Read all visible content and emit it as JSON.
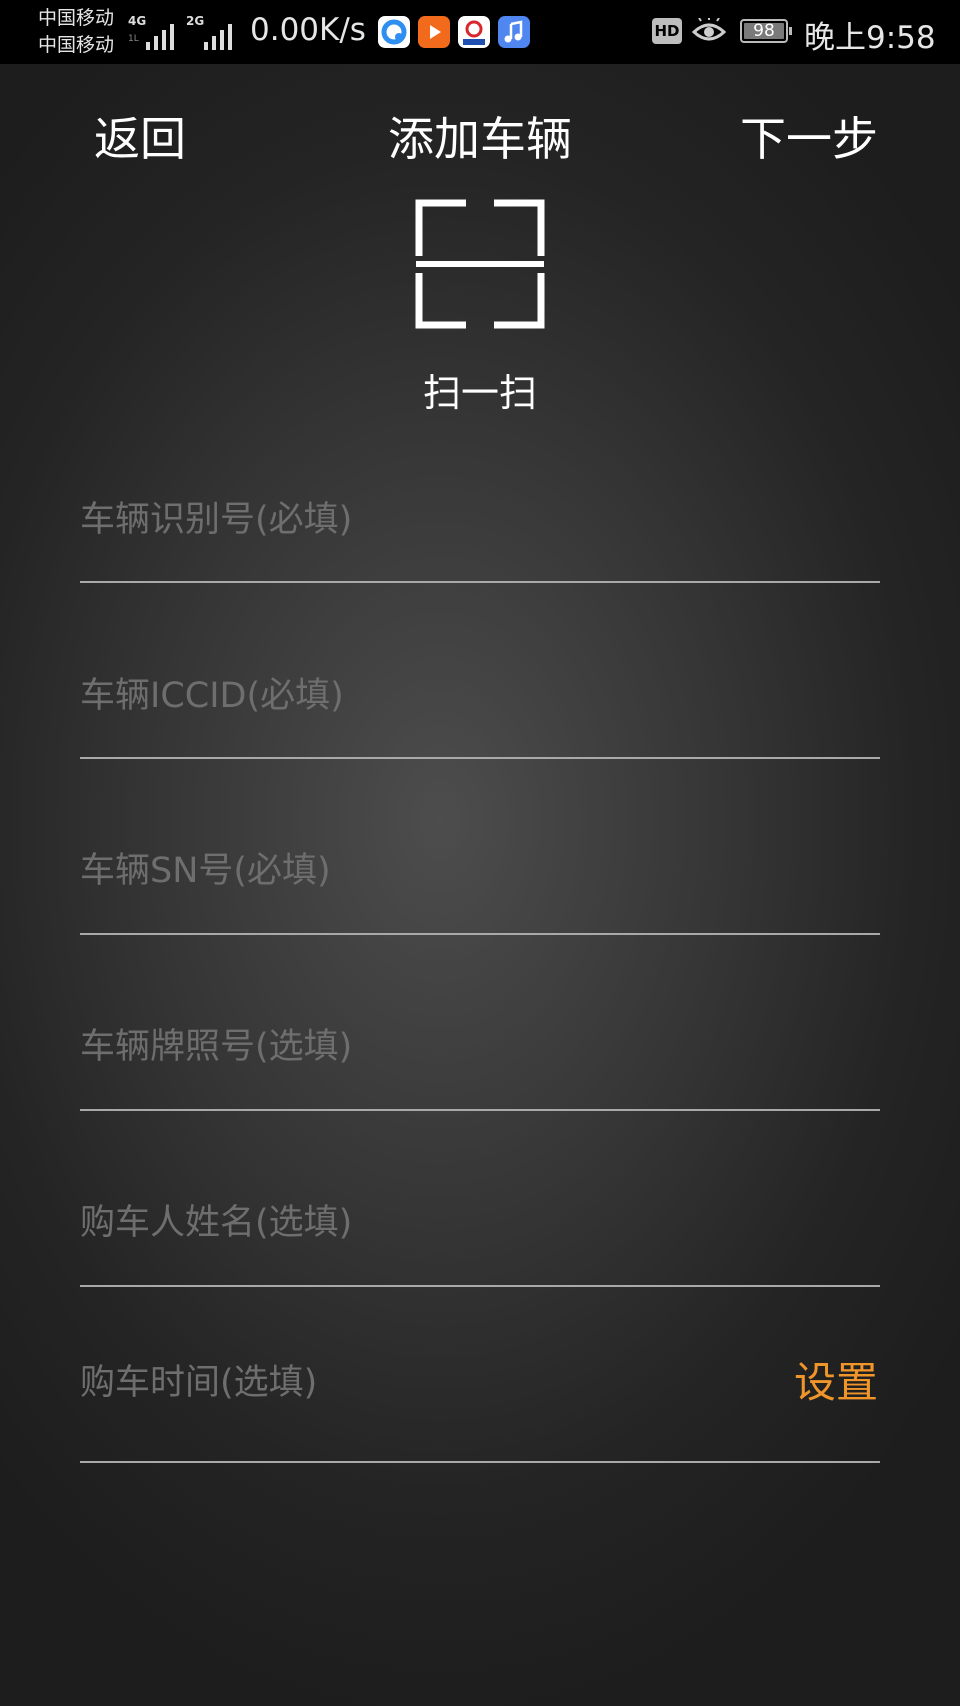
{
  "status_bar": {
    "carrier_1": "中国移动",
    "carrier_2": "中国移动",
    "signal_1_type": "4G",
    "signal_1_sub": "1L",
    "signal_2_type": "2G",
    "net_speed": "0.00K/s",
    "hd_badge": "HD",
    "battery_level": "98",
    "time": "晚上9:58",
    "icons": [
      "browser-app-icon",
      "video-app-icon",
      "news-app-icon",
      "music-app-icon",
      "eye-comfort-icon"
    ]
  },
  "nav": {
    "back_label": "返回",
    "title": "添加车辆",
    "next_label": "下一步"
  },
  "scan": {
    "label": "扫一扫"
  },
  "form": {
    "vin_placeholder": "车辆识别号(必填)",
    "iccid_placeholder": "车辆ICCID(必填)",
    "sn_placeholder": "车辆SN号(必填)",
    "plate_placeholder": "车辆牌照号(选填)",
    "buyer_name_placeholder": "购车人姓名(选填)",
    "purchase_time_label": "购车时间(选填)",
    "set_label": "设置"
  },
  "colors": {
    "accent": "#f0952a",
    "divider": "#a9a9a9",
    "placeholder": "#6e6e6e"
  }
}
